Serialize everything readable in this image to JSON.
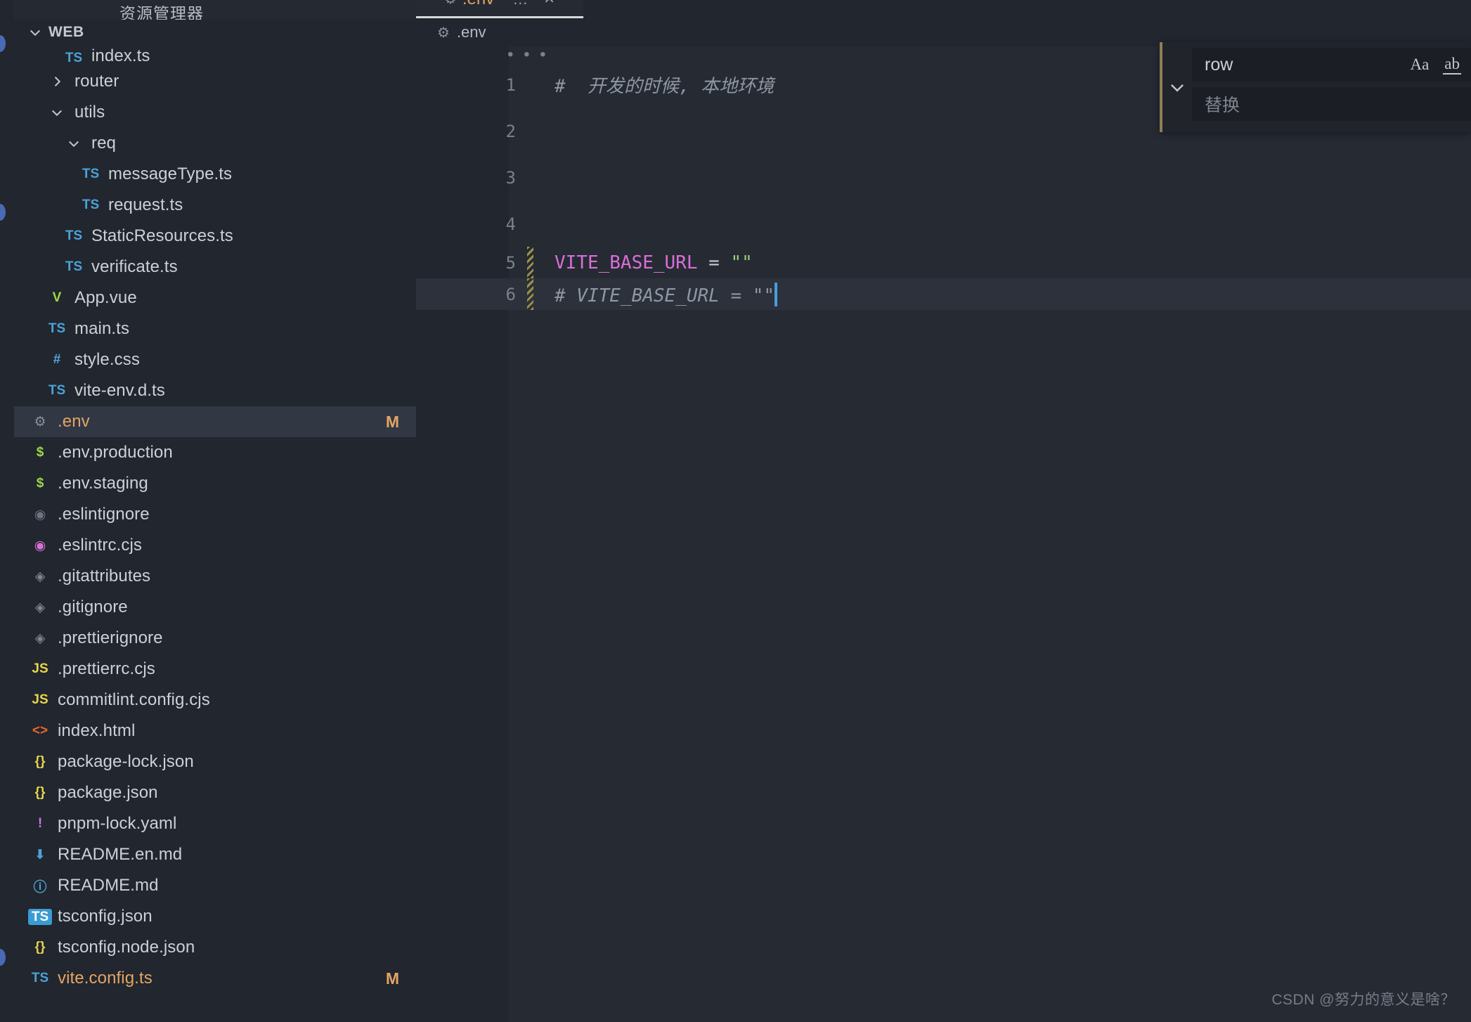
{
  "explorer": {
    "title": "资源管理器",
    "section_label": "WEB",
    "section_chevron": "chevron-down-icon",
    "items": [
      {
        "name": "index.ts",
        "icon": "ts-file-icon",
        "glyph": "TS",
        "indent": 2,
        "kind": "file",
        "modified": false,
        "badge": "",
        "clipped": true
      },
      {
        "name": "router",
        "icon": "chevron-right-icon",
        "glyph": "›",
        "indent": 1,
        "kind": "folder",
        "modified": false,
        "badge": "",
        "clipped": false
      },
      {
        "name": "utils",
        "icon": "chevron-down-icon",
        "glyph": "⌄",
        "indent": 1,
        "kind": "folder",
        "modified": false,
        "badge": "",
        "clipped": false
      },
      {
        "name": "req",
        "icon": "chevron-down-icon",
        "glyph": "⌄",
        "indent": 2,
        "kind": "folder",
        "modified": false,
        "badge": "",
        "clipped": false
      },
      {
        "name": "messageType.ts",
        "icon": "ts-file-icon",
        "glyph": "TS",
        "indent": 3,
        "kind": "file",
        "modified": false,
        "badge": "",
        "clipped": false
      },
      {
        "name": "request.ts",
        "icon": "ts-file-icon",
        "glyph": "TS",
        "indent": 3,
        "kind": "file",
        "modified": false,
        "badge": "",
        "clipped": false
      },
      {
        "name": "StaticResources.ts",
        "icon": "ts-file-icon",
        "glyph": "TS",
        "indent": 2,
        "kind": "file",
        "modified": false,
        "badge": "",
        "clipped": false
      },
      {
        "name": "verificate.ts",
        "icon": "ts-file-icon",
        "glyph": "TS",
        "indent": 2,
        "kind": "file",
        "modified": false,
        "badge": "",
        "clipped": false
      },
      {
        "name": "App.vue",
        "icon": "vue-file-icon",
        "glyph": "V",
        "indent": 1,
        "kind": "file",
        "modified": false,
        "badge": "",
        "clipped": false
      },
      {
        "name": "main.ts",
        "icon": "ts-file-icon",
        "glyph": "TS",
        "indent": 1,
        "kind": "file",
        "modified": false,
        "badge": "",
        "clipped": false
      },
      {
        "name": "style.css",
        "icon": "css-file-icon",
        "glyph": "#",
        "indent": 1,
        "kind": "file",
        "modified": false,
        "badge": "",
        "clipped": false
      },
      {
        "name": "vite-env.d.ts",
        "icon": "ts-file-icon",
        "glyph": "TS",
        "indent": 1,
        "kind": "file",
        "modified": false,
        "badge": "",
        "clipped": false
      },
      {
        "name": ".env",
        "icon": "gear-file-icon",
        "glyph": "⚙",
        "indent": 0,
        "kind": "file",
        "modified": true,
        "badge": "M",
        "clipped": false
      },
      {
        "name": ".env.production",
        "icon": "env-file-icon",
        "glyph": "$",
        "indent": 0,
        "kind": "file",
        "modified": false,
        "badge": "",
        "clipped": false
      },
      {
        "name": ".env.staging",
        "icon": "env-file-icon",
        "glyph": "$",
        "indent": 0,
        "kind": "file",
        "modified": false,
        "badge": "",
        "clipped": false
      },
      {
        "name": ".eslintignore",
        "icon": "eslint-ignore-icon",
        "glyph": "◉",
        "indent": 0,
        "kind": "file",
        "modified": false,
        "badge": "",
        "clipped": false
      },
      {
        "name": ".eslintrc.cjs",
        "icon": "eslint-icon",
        "glyph": "◉",
        "indent": 0,
        "kind": "file",
        "modified": false,
        "badge": "",
        "clipped": false
      },
      {
        "name": ".gitattributes",
        "icon": "git-file-icon",
        "glyph": "◈",
        "indent": 0,
        "kind": "file",
        "modified": false,
        "badge": "",
        "clipped": false
      },
      {
        "name": ".gitignore",
        "icon": "git-file-icon",
        "glyph": "◈",
        "indent": 0,
        "kind": "file",
        "modified": false,
        "badge": "",
        "clipped": false
      },
      {
        "name": ".prettierignore",
        "icon": "git-file-icon",
        "glyph": "◈",
        "indent": 0,
        "kind": "file",
        "modified": false,
        "badge": "",
        "clipped": false
      },
      {
        "name": ".prettierrc.cjs",
        "icon": "js-file-icon",
        "glyph": "JS",
        "indent": 0,
        "kind": "file",
        "modified": false,
        "badge": "",
        "clipped": false
      },
      {
        "name": "commitlint.config.cjs",
        "icon": "js-file-icon",
        "glyph": "JS",
        "indent": 0,
        "kind": "file",
        "modified": false,
        "badge": "",
        "clipped": false
      },
      {
        "name": "index.html",
        "icon": "html-file-icon",
        "glyph": "<>",
        "indent": 0,
        "kind": "file",
        "modified": false,
        "badge": "",
        "clipped": false
      },
      {
        "name": "package-lock.json",
        "icon": "json-file-icon",
        "glyph": "{}",
        "indent": 0,
        "kind": "file",
        "modified": false,
        "badge": "",
        "clipped": false
      },
      {
        "name": "package.json",
        "icon": "json-file-icon",
        "glyph": "{}",
        "indent": 0,
        "kind": "file",
        "modified": false,
        "badge": "",
        "clipped": false
      },
      {
        "name": "pnpm-lock.yaml",
        "icon": "yaml-file-icon",
        "glyph": "!",
        "indent": 0,
        "kind": "file",
        "modified": false,
        "badge": "",
        "clipped": false
      },
      {
        "name": "README.en.md",
        "icon": "markdown-down-icon",
        "glyph": "⬇",
        "indent": 0,
        "kind": "file",
        "modified": false,
        "badge": "",
        "clipped": false
      },
      {
        "name": "README.md",
        "icon": "markdown-info-icon",
        "glyph": "ⓘ",
        "indent": 0,
        "kind": "file",
        "modified": false,
        "badge": "",
        "clipped": false
      },
      {
        "name": "tsconfig.json",
        "icon": "tsconfig-icon",
        "glyph": "TS",
        "indent": 0,
        "kind": "file",
        "modified": false,
        "badge": "",
        "clipped": false
      },
      {
        "name": "tsconfig.node.json",
        "icon": "json-file-icon",
        "glyph": "{}",
        "indent": 0,
        "kind": "file",
        "modified": false,
        "badge": "",
        "clipped": false
      },
      {
        "name": "vite.config.ts",
        "icon": "ts-file-icon",
        "glyph": "TS",
        "indent": 0,
        "kind": "file",
        "modified": true,
        "badge": "M",
        "clipped": false
      }
    ]
  },
  "editor": {
    "tab": {
      "icon": "gear-file-icon",
      "label": ".env",
      "dots_label": "…",
      "close_label": "✕"
    },
    "breadcrumb": {
      "icon": "gear-file-icon",
      "label": ".env"
    },
    "fold_indicator": "• • •",
    "lines": [
      {
        "no": "1",
        "text": "#  开发的时候, 本地环境",
        "style": "comment",
        "dirty": false,
        "current": false
      },
      {
        "no": "2",
        "text": "",
        "style": "plain",
        "dirty": false,
        "current": false
      },
      {
        "no": "3",
        "text": "",
        "style": "plain",
        "dirty": false,
        "current": false
      },
      {
        "no": "4",
        "text": "",
        "style": "plain",
        "dirty": false,
        "current": false
      },
      {
        "no": "5",
        "text": "VITE_BASE_URL = \"\"",
        "style": "assignment",
        "dirty": true,
        "current": false
      },
      {
        "no": "6",
        "text": "# VITE_BASE_URL = \"\"",
        "style": "comment",
        "dirty": true,
        "current": true
      }
    ],
    "line5": {
      "var": "VITE_BASE_URL",
      "op": " = ",
      "value": "\"\""
    },
    "line6": {
      "text": "# VITE_BASE_URL = \"\""
    }
  },
  "find_widget": {
    "toggle_icon": "chevron-down-icon",
    "find_value": "row",
    "replace_placeholder": "替换",
    "match_case_label": "Aa",
    "whole_word_label": "ab"
  },
  "watermark": "CSDN @努力的意义是啥？",
  "colors": {
    "sidebar_bg": "#22262e",
    "editor_bg": "#262a33",
    "selected_row": "#313743",
    "modified_text": "#e3a563",
    "ts_blue": "#4aa3d8",
    "accent_cursor": "#4a9be0",
    "find_border": "#8a8057"
  }
}
